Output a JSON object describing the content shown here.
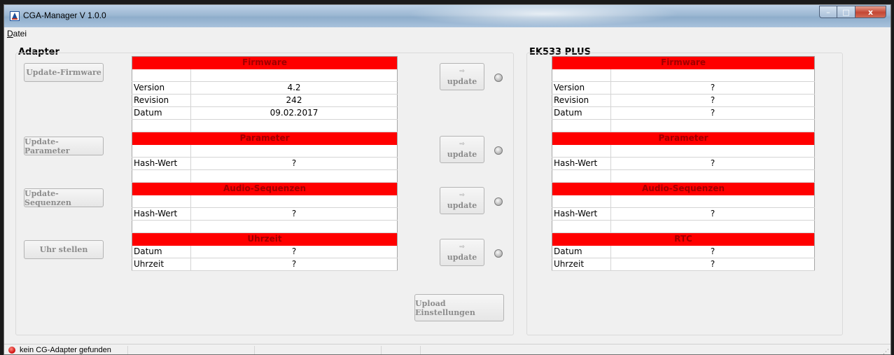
{
  "window": {
    "title": "CGA-Manager V 1.0.0",
    "minimize": "–",
    "maximize": "□",
    "close": "x"
  },
  "menu": {
    "datei": "Datei"
  },
  "adapter": {
    "title": "Adapter",
    "buttons": {
      "update_firmware": "Update-Firmware",
      "update_parameter": "Update-Parameter",
      "update_sequenzen": "Update-Sequenzen",
      "uhr_stellen": "Uhr stellen"
    },
    "firmware": {
      "header": "Firmware",
      "rows": [
        {
          "label": "",
          "value": ""
        },
        {
          "label": "Version",
          "value": "4.2"
        },
        {
          "label": "Revision",
          "value": "242"
        },
        {
          "label": "Datum",
          "value": "09.02.2017"
        },
        {
          "label": "",
          "value": ""
        }
      ]
    },
    "parameter": {
      "header": "Parameter",
      "rows": [
        {
          "label": "",
          "value": ""
        },
        {
          "label": "Hash-Wert",
          "value": "?"
        },
        {
          "label": "",
          "value": ""
        }
      ]
    },
    "audio": {
      "header": "Audio-Sequenzen",
      "rows": [
        {
          "label": "",
          "value": ""
        },
        {
          "label": "Hash-Wert",
          "value": "?"
        },
        {
          "label": "",
          "value": ""
        }
      ]
    },
    "uhrzeit": {
      "header": "Uhrzeit",
      "rows": [
        {
          "label": "Datum",
          "value": "?"
        },
        {
          "label": "Uhrzeit",
          "value": "?"
        }
      ]
    }
  },
  "transfer": {
    "update_label": "update",
    "arrow": "⇨",
    "upload": "Upload Einstellungen"
  },
  "device": {
    "title": "EK533 PLUS",
    "firmware": {
      "header": "Firmware",
      "rows": [
        {
          "label": "",
          "value": ""
        },
        {
          "label": "Version",
          "value": "?"
        },
        {
          "label": "Revision",
          "value": "?"
        },
        {
          "label": "Datum",
          "value": "?"
        },
        {
          "label": "",
          "value": ""
        }
      ]
    },
    "parameter": {
      "header": "Parameter",
      "rows": [
        {
          "label": "",
          "value": ""
        },
        {
          "label": "Hash-Wert",
          "value": "?"
        },
        {
          "label": "",
          "value": ""
        }
      ]
    },
    "audio": {
      "header": "Audio-Sequenzen",
      "rows": [
        {
          "label": "",
          "value": ""
        },
        {
          "label": "Hash-Wert",
          "value": "?"
        },
        {
          "label": "",
          "value": ""
        }
      ]
    },
    "rtc": {
      "header": "RTC",
      "rows": [
        {
          "label": "Datum",
          "value": "?"
        },
        {
          "label": "Uhrzeit",
          "value": "?"
        }
      ]
    }
  },
  "status": {
    "text": "kein CG-Adapter gefunden",
    "led_color": "#d01010",
    "icon": "red-led-icon"
  },
  "colors": {
    "table_header": "#ff0000",
    "table_header_text": "#a00000"
  }
}
